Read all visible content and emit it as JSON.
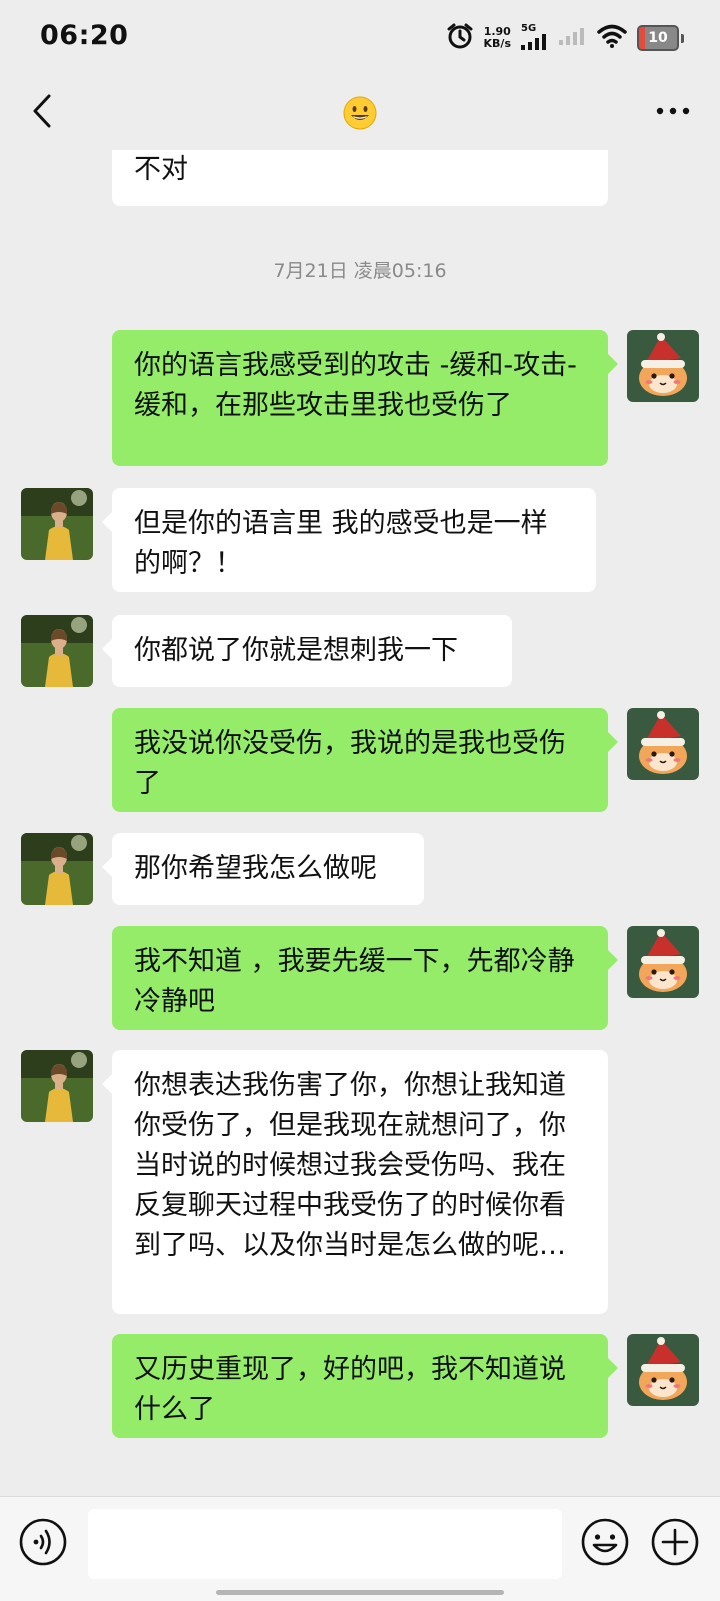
{
  "status_bar": {
    "time": "06:20",
    "net_speed_value": "1.90",
    "net_speed_unit": "KB/s",
    "network": "5G",
    "battery": "10",
    "icons": [
      "alarm-icon",
      "signal-icon",
      "wifi-icon",
      "battery-icon"
    ]
  },
  "header": {
    "title_icon": "grinning-emoji-icon",
    "back_icon": "chevron-left-icon",
    "more_icon": "more-dots-icon"
  },
  "messages": [
    {
      "side": "in",
      "text": "不对",
      "partial": true
    },
    {
      "type": "time",
      "text": "7月21日 凌晨05:16"
    },
    {
      "side": "out",
      "text": "你的语言我感受到的攻击 -缓和-攻击-缓和，在那些攻击里我也受伤了"
    },
    {
      "side": "in",
      "text": "但是你的语言里 我的感受也是一样的啊？！"
    },
    {
      "side": "in",
      "text": "你都说了你就是想刺我一下"
    },
    {
      "side": "out",
      "text": "我没说你没受伤，我说的是我也受伤了"
    },
    {
      "side": "in",
      "text": "那你希望我怎么做呢"
    },
    {
      "side": "out",
      "text": "我不知道 ，我要先缓一下，先都冷静冷静吧"
    },
    {
      "side": "in",
      "text": "你想表达我伤害了你，你想让我知道你受伤了，但是我现在就想问了，你当时说的时候想过我会受伤吗、我在反复聊天过程中我受伤了的时候你看到了吗、以及你当时是怎么做的呢…"
    },
    {
      "side": "out",
      "text": "又历史重现了，好的吧，我不知道说什么了"
    }
  ],
  "input_bar": {
    "placeholder": "",
    "voice_icon": "voice-icon",
    "emoji_icon": "emoji-icon",
    "plus_icon": "plus-icon"
  },
  "colors": {
    "background": "#ededed",
    "outgoing_bubble": "#95ec69",
    "incoming_bubble": "#ffffff",
    "timestamp": "#8a8a8a"
  }
}
